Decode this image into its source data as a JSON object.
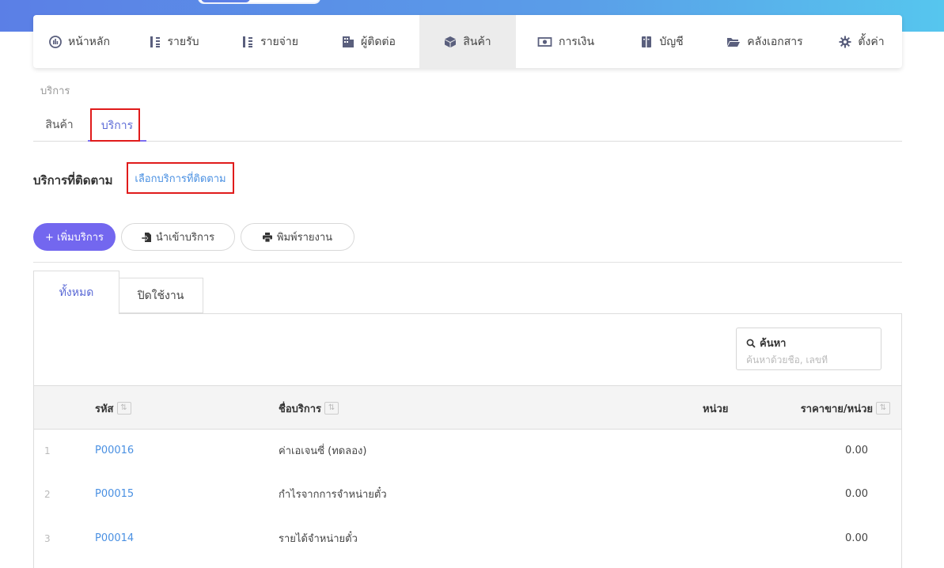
{
  "nav": {
    "items": [
      {
        "label": "หน้าหลัก",
        "icon": "dashboard-icon"
      },
      {
        "label": "รายรับ",
        "icon": "income-icon"
      },
      {
        "label": "รายจ่าย",
        "icon": "expense-icon"
      },
      {
        "label": "ผู้ติดต่อ",
        "icon": "contacts-icon"
      },
      {
        "label": "สินค้า",
        "icon": "box-icon"
      },
      {
        "label": "การเงิน",
        "icon": "money-icon"
      },
      {
        "label": "บัญชี",
        "icon": "ledger-icon"
      },
      {
        "label": "คลังเอกสาร",
        "icon": "folder-icon"
      },
      {
        "label": "ตั้งค่า",
        "icon": "gear-icon"
      }
    ]
  },
  "breadcrumb": "บริการ",
  "subtabs": {
    "products": "สินค้า",
    "services": "บริการ"
  },
  "follow": {
    "label": "บริการที่ติดตาม",
    "link": "เลือกบริการที่ติดตาม"
  },
  "actions": {
    "add": "+ เพิ่มบริการ",
    "import": "นำเข้าบริการ",
    "print": "พิมพ์รายงาน"
  },
  "filter_tabs": {
    "all": "ทั้งหมด",
    "disabled": "ปิดใช้งาน"
  },
  "search": {
    "title": "ค้นหา",
    "placeholder": "ค้นหาด้วยชื่อ, เลขที่"
  },
  "table": {
    "headers": {
      "code": "รหัส",
      "name": "ชื่อบริการ",
      "unit": "หน่วย",
      "price": "ราคาขาย/หน่วย"
    },
    "rows": [
      {
        "idx": "1",
        "code": "P00016",
        "name": "ค่าเอเจนซี่ (ทดลอง)",
        "unit": "",
        "price": "0.00"
      },
      {
        "idx": "2",
        "code": "P00015",
        "name": "กำไรจากการจำหน่ายตั๋ว",
        "unit": "",
        "price": "0.00"
      },
      {
        "idx": "3",
        "code": "P00014",
        "name": "รายได้จำหน่ายตั๋ว",
        "unit": "",
        "price": "0.00"
      }
    ]
  },
  "colors": {
    "primary": "#7367ef",
    "link": "#4a90e2",
    "highlight": "#e01b1b"
  }
}
